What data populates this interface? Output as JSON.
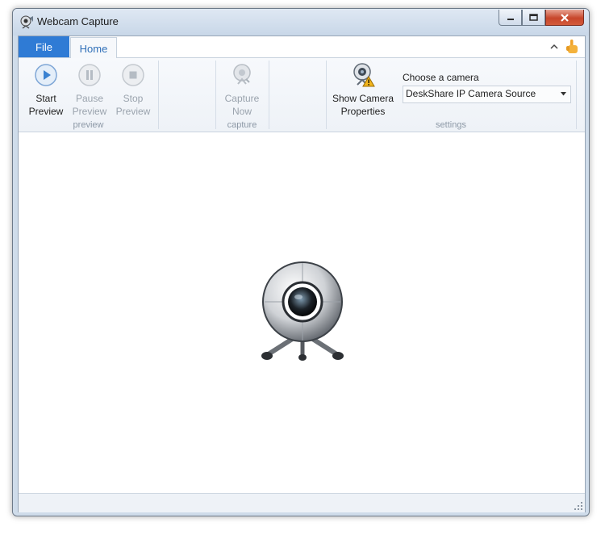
{
  "window": {
    "title": "Webcam Capture"
  },
  "tabs": {
    "file": "File",
    "home": "Home"
  },
  "ribbon": {
    "preview_group": {
      "label": "preview",
      "start": {
        "line1": "Start",
        "line2": "Preview"
      },
      "pause": {
        "line1": "Pause",
        "line2": "Preview"
      },
      "stop": {
        "line1": "Stop",
        "line2": "Preview"
      }
    },
    "capture_group": {
      "label": "capture",
      "capture_now": {
        "line1": "Capture",
        "line2": "Now"
      }
    },
    "settings_group": {
      "label": "settings",
      "show_props": {
        "line1": "Show Camera",
        "line2": "Properties"
      },
      "choose_label": "Choose a camera",
      "camera_value": "DeskShare IP Camera Source"
    }
  },
  "icons": {
    "start": "play-icon",
    "pause": "pause-icon",
    "stop": "stop-icon",
    "capture": "webcam-capture-icon",
    "properties": "webcam-warning-icon",
    "preview": "webcam-icon"
  },
  "colors": {
    "file_tab": "#2f7bd5",
    "home_tab_text": "#2f6fb8",
    "close_button": "#c7462b"
  }
}
